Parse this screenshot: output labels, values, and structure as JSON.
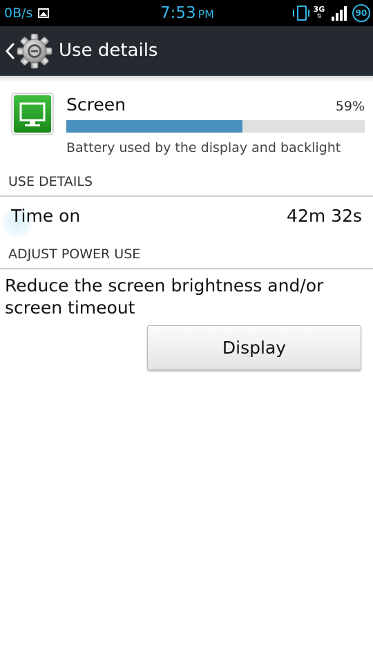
{
  "status_bar": {
    "net_speed": "0B/s",
    "time": "7:53",
    "ampm": "PM",
    "network_type": "3G",
    "battery_level": "90"
  },
  "action_bar": {
    "title": "Use details"
  },
  "app": {
    "name": "Screen",
    "percent": "59%",
    "usage_fraction": 0.59,
    "description": "Battery used by the display and backlight"
  },
  "use_details": {
    "header": "USE DETAILS",
    "rows": [
      {
        "label": "Time on",
        "value": "42m 32s"
      }
    ]
  },
  "adjust_power": {
    "header": "ADJUST POWER USE",
    "text": "Reduce the screen brightness and/or screen timeout",
    "button_label": "Display"
  },
  "colors": {
    "status_accent": "#33b5e5",
    "action_bar": "#252a31",
    "progress": "#4a90bf"
  },
  "icons": {
    "image": "image-icon",
    "vibrate": "vibrate-icon",
    "signal": "signal-icon",
    "battery": "battery-icon",
    "back": "back-chevron-icon",
    "settings": "gear-icon",
    "app": "screen-monitor-icon"
  }
}
